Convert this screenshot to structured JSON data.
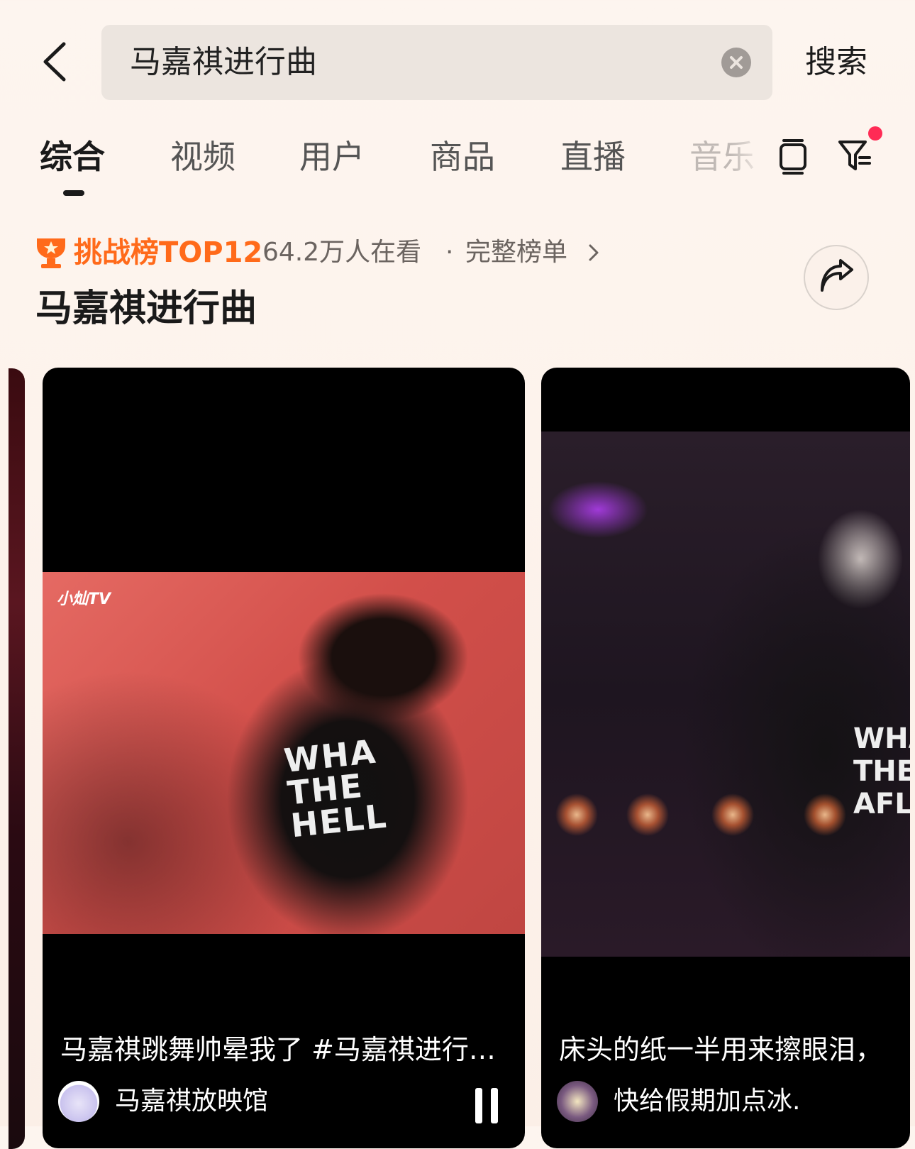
{
  "search": {
    "query": "马嘉祺进行曲",
    "submit_label": "搜索"
  },
  "tabs": [
    {
      "label": "综合",
      "active": true
    },
    {
      "label": "视频"
    },
    {
      "label": "用户"
    },
    {
      "label": "商品"
    },
    {
      "label": "直播"
    },
    {
      "label": "音乐"
    }
  ],
  "challenge": {
    "rank_label": "挑战榜TOP12",
    "watching": "64.2万人在看",
    "separator": "·",
    "full_list": "完整榜单",
    "topic_title": "马嘉祺进行曲"
  },
  "videos": [
    {
      "caption": "马嘉祺跳舞帅晕我了 #马嘉祺进行…",
      "author": "马嘉祺放映馆",
      "watermark": "小灿TV",
      "shirt_text": "WHA THE HELL"
    },
    {
      "caption": "床头的纸一半用来擦眼泪，",
      "author": "快给假期加点冰.",
      "shirt_text": "WHA THE AFL"
    }
  ],
  "colors": {
    "accent_orange": "#ff6a1a",
    "notification_dot": "#ff2b55"
  }
}
